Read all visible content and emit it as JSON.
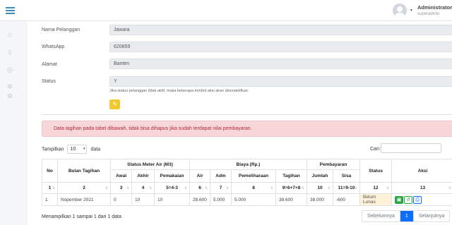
{
  "header": {
    "user_name": "Administrator",
    "user_role": "superadmin"
  },
  "form": {
    "nama_label": "Nama Pelanggan",
    "nama_value": "Jawara",
    "wa_label": "WhatsApp",
    "wa_value": "620859",
    "alamat_label": "Alamat",
    "alamat_value": "Banten",
    "status_label": "Status",
    "status_value": "Y",
    "status_hint": "Jika status pelanggan tidak aktif, maka beberapa tombol aksi akan dinonaktifkan."
  },
  "alert": "Data tagihan pada tabel dibawah, tidak bisa dihapus jika sudah terdapat nilai pembayaran.",
  "table_controls": {
    "show_label": "Tampilkan",
    "show_value": "10",
    "entries_label": "data",
    "search_label": "Cari:"
  },
  "table": {
    "groups": {
      "no": "No",
      "bulan": "Bulan Tagihan",
      "meter": "Status Meter Air (M3)",
      "biaya": "Biaya (Rp.)",
      "pembayaran": "Pembayaran",
      "status": "Status",
      "aksi": "Aksi"
    },
    "subheaders": [
      "Awal",
      "Akhir",
      "Pemakaian",
      "Air",
      "Adm",
      "Pemeliharaan",
      "Tagihan",
      "Jumlah",
      "Sisa"
    ],
    "numbers": [
      "1",
      "2",
      "3",
      "4",
      "5=4-3",
      "6",
      "7",
      "8",
      "9=6+7+8",
      "10",
      "11=9-10",
      "12",
      "13"
    ],
    "rows": [
      {
        "no": "1",
        "bulan": "Nopember 2021",
        "awal": "0",
        "akhir": "10",
        "pemakaian": "10",
        "air": "28.600",
        "adm": "5.000",
        "pemeliharaan": "5.000",
        "tagihan": "38.600",
        "jumlah": "38.000",
        "sisa": "-600",
        "status": "Belum Lunas"
      }
    ]
  },
  "footer": {
    "info": "Menampilkan 1 sampai 1 dari 1 data",
    "prev": "Sebelumnya",
    "page": "1",
    "next": "Selanjutnya"
  },
  "colors": {
    "accent": "#0d6efd",
    "alert_bg": "#f8d7da",
    "edit_btn": "#f0c92f",
    "status_bg": "#fdf1d8"
  }
}
